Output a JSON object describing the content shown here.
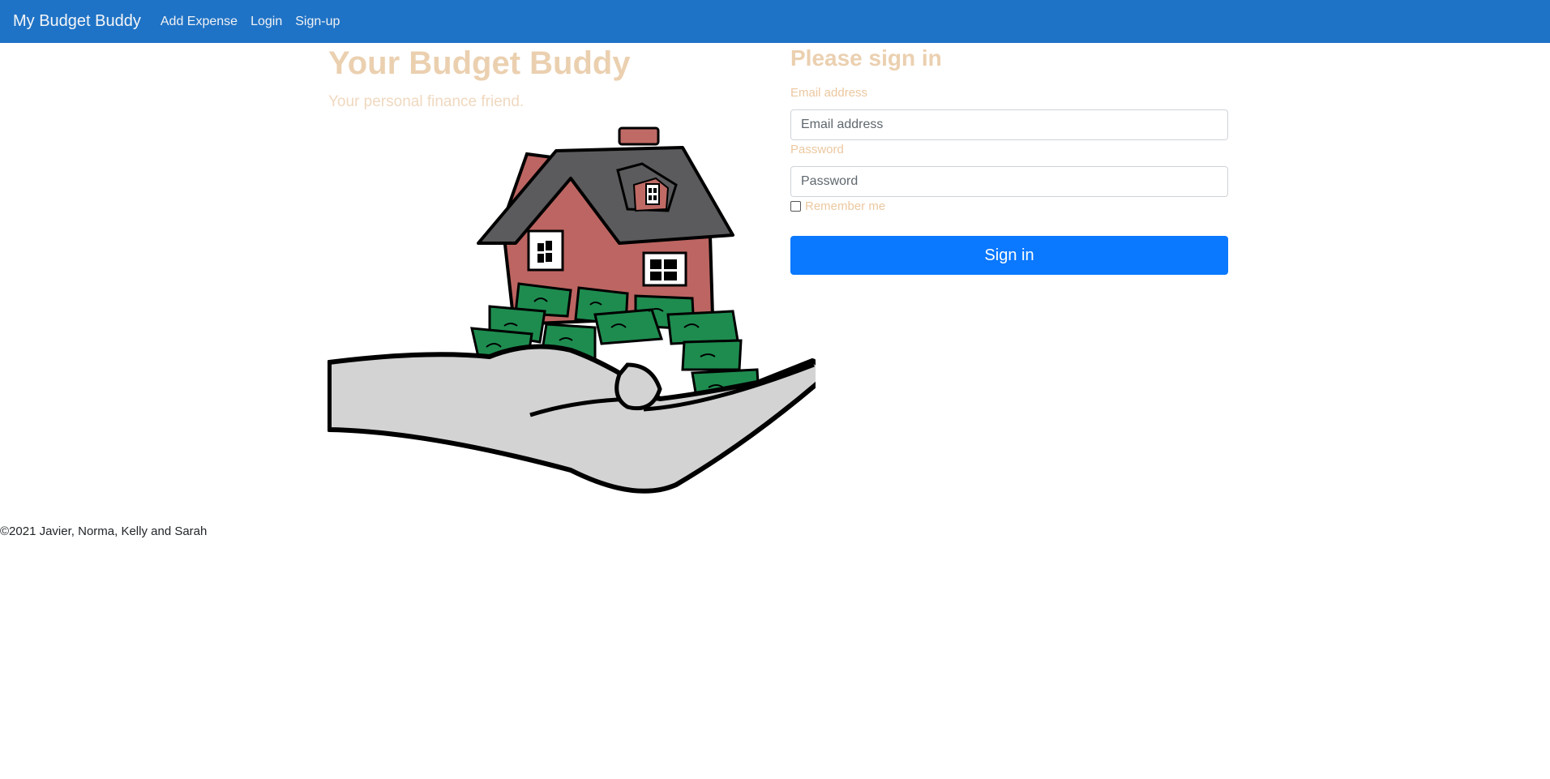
{
  "navbar": {
    "brand": "My Budget Buddy",
    "links": [
      "Add Expense",
      "Login",
      "Sign-up"
    ]
  },
  "hero": {
    "title": "Your Budget Buddy",
    "subtitle": "Your personal finance friend.",
    "image_icon": "hand-holding-house-and-money-illustration"
  },
  "signin": {
    "title": "Please sign in",
    "email_label": "Email address",
    "email_placeholder": "Email address",
    "email_value": "",
    "password_label": "Password",
    "password_placeholder": "Password",
    "password_value": "",
    "remember_label": "Remember me",
    "remember_checked": false,
    "button_label": "Sign in"
  },
  "footer": {
    "text": "©2021 Javier, Norma, Kelly and Sarah"
  },
  "colors": {
    "navbar": "#1f73c6",
    "accent_text": "#ebd0b0",
    "button": "#0a78ff"
  }
}
